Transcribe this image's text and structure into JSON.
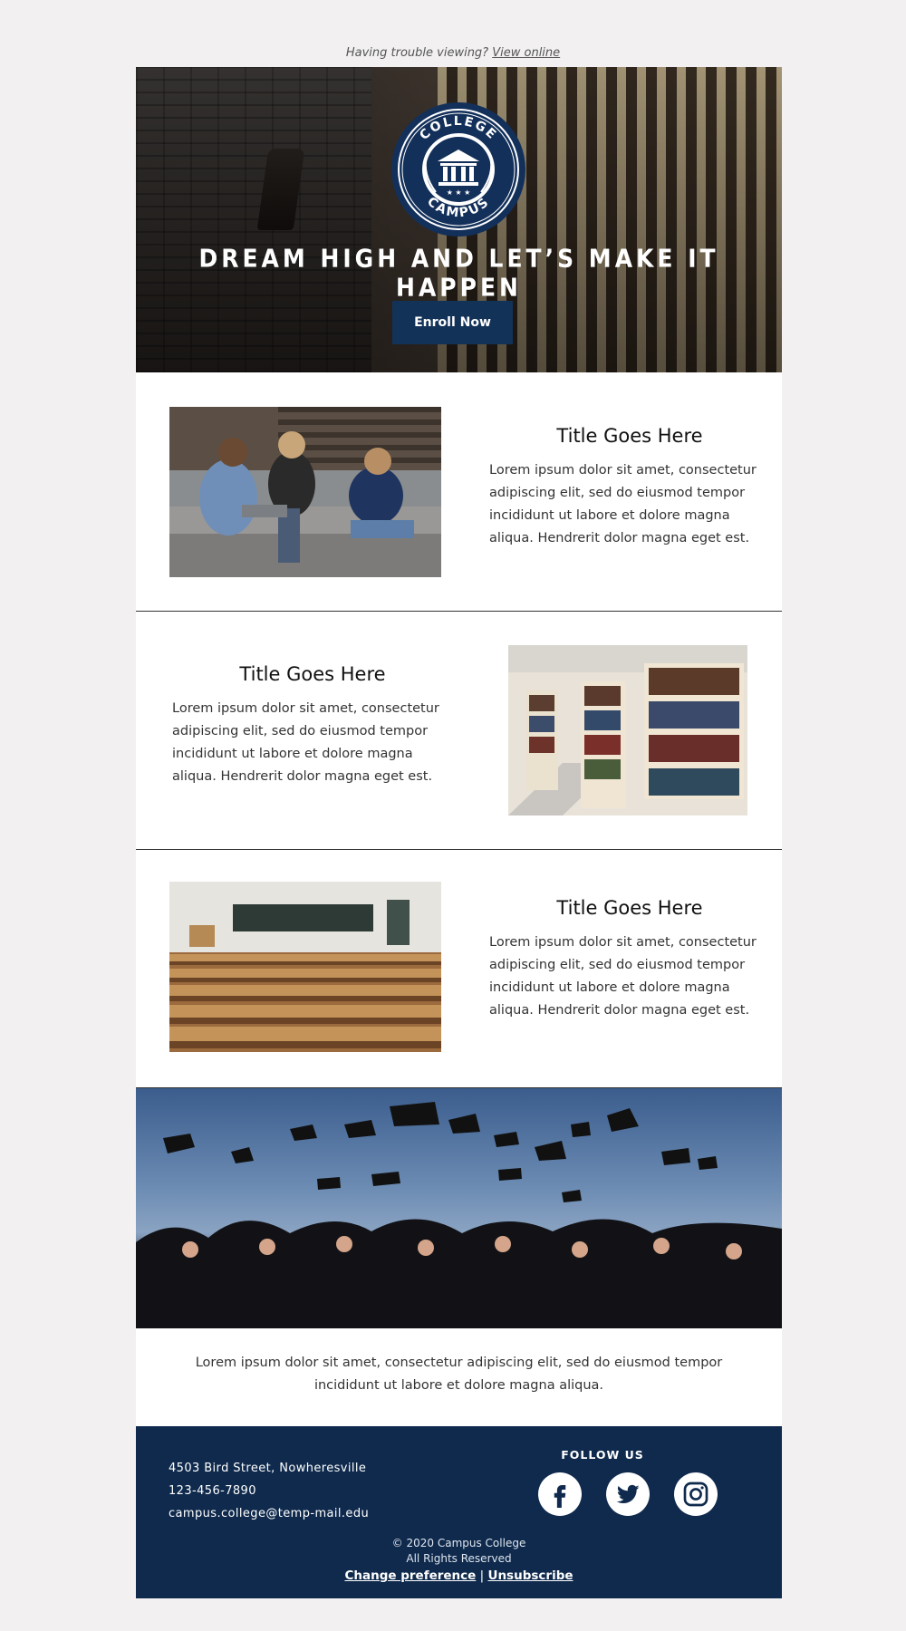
{
  "preheader": {
    "text": "Having trouble viewing?",
    "link": "View online"
  },
  "hero": {
    "badge_top": "COLLEGE",
    "badge_bottom": "CAMPUS",
    "headline": "DREAM HIGH AND LET’S MAKE IT HAPPEN",
    "cta": "Enroll Now"
  },
  "features": [
    {
      "title": "Title Goes Here",
      "body": "Lorem ipsum dolor sit amet, consectetur adipiscing elit, sed do eiusmod tempor incididunt ut labore et dolore magna aliqua. Hendrerit dolor magna eget est."
    },
    {
      "title": "Title Goes Here",
      "body": "Lorem ipsum dolor sit amet, consectetur adipiscing elit, sed do eiusmod tempor incididunt ut labore et dolore magna aliqua. Hendrerit dolor magna eget est."
    },
    {
      "title": "Title Goes Here",
      "body": "Lorem ipsum dolor sit amet, consectetur adipiscing elit, sed do eiusmod tempor incididunt ut labore et dolore magna aliqua. Hendrerit dolor magna eget est."
    }
  ],
  "caption": "Lorem ipsum dolor sit amet, consectetur adipiscing elit, sed do eiusmod tempor incididunt ut labore et dolore magna aliqua.",
  "footer": {
    "address": "4503 Bird Street, Nowheresville",
    "phone": "123-456-7890",
    "email": "campus.college@temp-mail.edu",
    "follow_label": "FOLLOW US",
    "socials": [
      "facebook-icon",
      "twitter-icon",
      "instagram-icon"
    ],
    "copyright": "© 2020 Campus College",
    "rights": "All Rights Reserved",
    "change_pref": "Change preference",
    "separator": "|",
    "unsubscribe": "Unsubscribe"
  },
  "colors": {
    "brand_navy": "#0f2a4d",
    "button_navy": "#133258",
    "background": "#f2f0f1"
  }
}
